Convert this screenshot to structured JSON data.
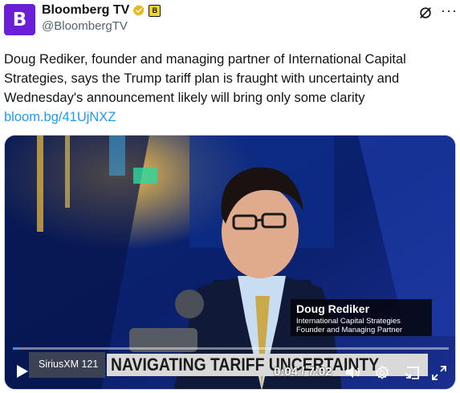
{
  "author": {
    "avatar_letter": "B",
    "display_name": "Bloomberg TV",
    "handle": "@BloombergTV",
    "affiliate_badge_letter": "B",
    "avatar_color": "#6a1fd6",
    "verified_color": "#e8b923"
  },
  "post": {
    "text": "Doug Rediker, founder and managing partner of International Capital Strategies, says the Trump tariff plan is fraught with uncertainty and Wednesday's announcement likely will bring only some clarity",
    "link": "bloom.bg/41UjNXZ",
    "link_color": "#1d9bf0"
  },
  "video": {
    "lower_third_name": "Doug Rediker",
    "lower_third_line1": "International Capital Strategies",
    "lower_third_line2": "Founder and Managing Partner",
    "channel_label": "SiriusXM 121",
    "headline": "NAVIGATING TARIFF UNCERTAINTY",
    "time_display": "0:04 / 7:02",
    "progress_fraction": 0.0095
  },
  "icons": {
    "header_right": [
      "grok-icon",
      "more-icon"
    ],
    "controls": [
      "play-icon",
      "volume-icon",
      "gear-icon",
      "pip-icon",
      "fullscreen-icon"
    ]
  }
}
